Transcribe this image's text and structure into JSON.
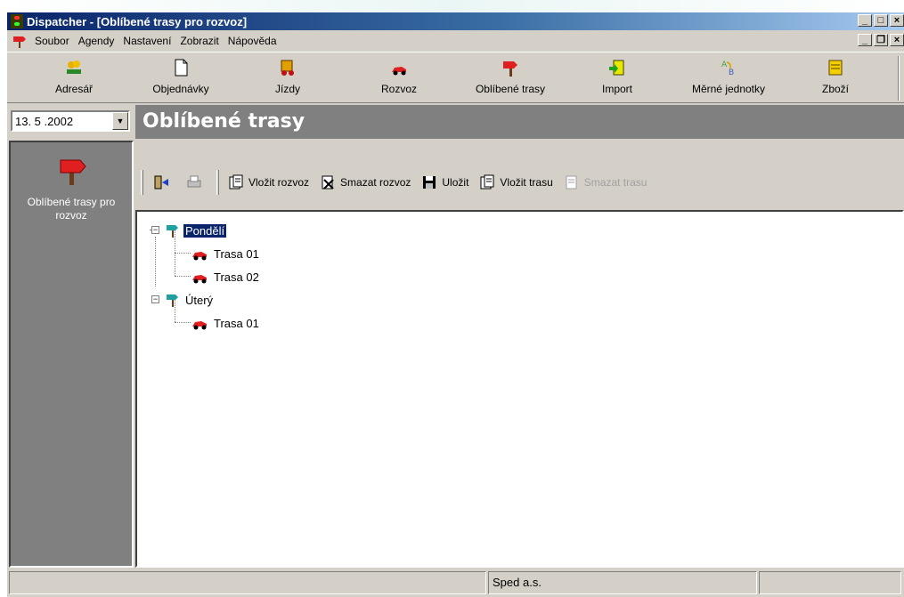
{
  "window": {
    "title": "Dispatcher - [Oblíbené trasy pro rozvoz]",
    "controls": [
      "_",
      "□",
      "×"
    ],
    "mdi_controls": [
      "_",
      "❐",
      "×"
    ]
  },
  "menu": {
    "items": [
      "Soubor",
      "Agendy",
      "Nastavení",
      "Zobrazit",
      "Nápověda"
    ]
  },
  "toolbar": {
    "buttons": [
      {
        "label": "Adresář",
        "icon": "address-book-icon"
      },
      {
        "label": "Objednávky",
        "icon": "document-icon"
      },
      {
        "label": "Jízdy",
        "icon": "truck-icon"
      },
      {
        "label": "Rozvoz",
        "icon": "car-icon"
      },
      {
        "label": "Oblíbené trasy",
        "icon": "signpost-icon"
      },
      {
        "label": "Import",
        "icon": "import-icon"
      },
      {
        "label": "Měrné jednotky",
        "icon": "units-icon"
      },
      {
        "label": "Zboží",
        "icon": "goods-icon"
      }
    ]
  },
  "date_picker": {
    "value": "13. 5 .2002"
  },
  "page": {
    "title": "Oblíbené trasy"
  },
  "side": {
    "label": "Oblíbené trasy pro rozvoz"
  },
  "subtoolbar": {
    "buttons": [
      {
        "label": "Vložit rozvoz",
        "enabled": true
      },
      {
        "label": "Smazat rozvoz",
        "enabled": true
      },
      {
        "label": "Uložit",
        "enabled": true
      },
      {
        "label": "Vložit trasu",
        "enabled": true
      },
      {
        "label": "Smazat trasu",
        "enabled": false
      }
    ]
  },
  "tree": [
    {
      "label": "Pondělí",
      "selected": true,
      "children": [
        "Trasa 01",
        "Trasa 02"
      ]
    },
    {
      "label": "Úterý",
      "selected": false,
      "children": [
        "Trasa 01"
      ]
    }
  ],
  "status": {
    "company": "Sped a.s."
  },
  "colors": {
    "title_bar": "#0a246a",
    "panel_gray": "#808080",
    "face": "#d4d0c8",
    "selection": "#0a246a"
  }
}
